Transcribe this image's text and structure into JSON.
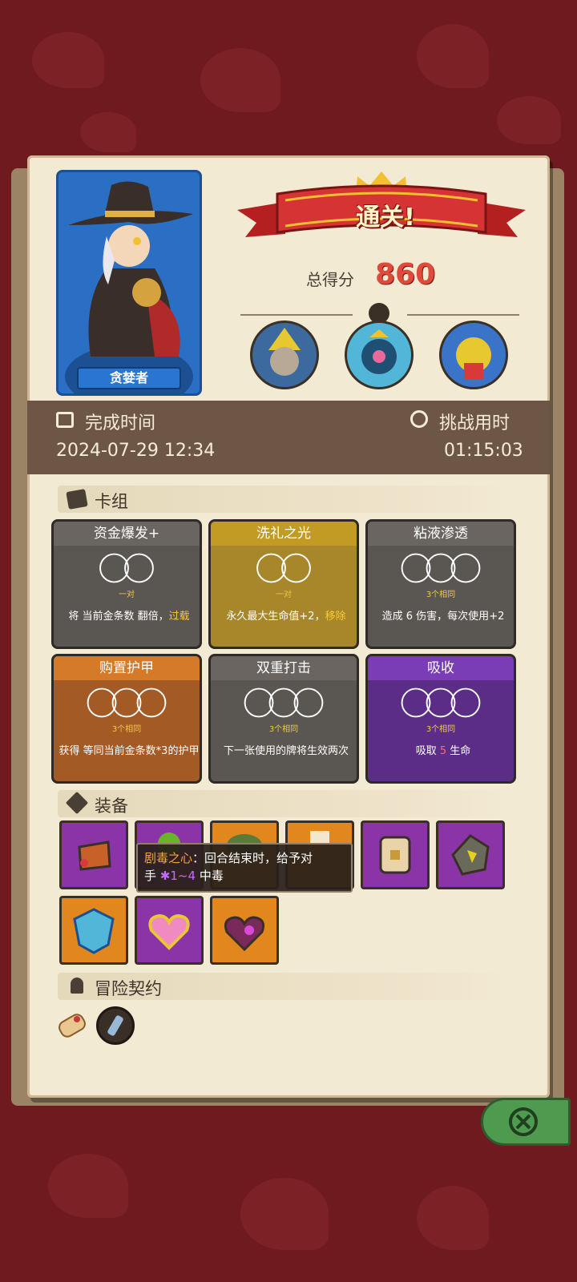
{
  "result": {
    "banner": "通关!",
    "score_label": "总得分",
    "score_value": "860"
  },
  "character": {
    "name": "贪婪者"
  },
  "stats": {
    "completion_label": "完成时间",
    "completion_value": "2024-07-29 12:34",
    "duration_label": "挑战用时",
    "duration_value": "01:15:03"
  },
  "deck": {
    "title": "卡组",
    "cards": [
      {
        "name": "资金爆发+",
        "sub": "一对",
        "desc_a": "将 当前",
        "desc_b": "金条数 翻倍，",
        "desc_hl": "过载",
        "color": "#5a5652",
        "head": "#6a6561"
      },
      {
        "name": "洗礼之光",
        "sub": "一对",
        "desc_a": "永久最大生命值",
        "desc_b": "+2，",
        "desc_hl": "移除",
        "color": "#a8862a",
        "head": "#c29b24"
      },
      {
        "name": "粘液渗透",
        "sub": "3个相同",
        "desc_a": "造成",
        "desc_b": "6 伤害，每次使用",
        "desc_hl": "+2",
        "color": "#5a5652",
        "head": "#6a6561"
      },
      {
        "name": "购置护甲",
        "sub": "3个相同",
        "desc_a": "获得 等同当前",
        "desc_b": "金条数*3",
        "desc_hl": "的护甲",
        "color": "#a35a25",
        "head": "#d57a28"
      },
      {
        "name": "双重打击",
        "sub": "3个相同",
        "desc_a": "下一张使用的牌将生效两",
        "desc_b": "",
        "desc_hl": "次",
        "color": "#5a5652",
        "head": "#6a6561"
      },
      {
        "name": "吸收",
        "sub": "3个相同",
        "desc_a": "吸取",
        "desc_b": "5",
        "desc_hl": "生命",
        "color": "#5b2d87",
        "head": "#7a3db5"
      }
    ]
  },
  "equipment": {
    "title": "装备",
    "tooltip_name": "剧毒之心",
    "tooltip_text": "：回合结束时，给予对",
    "tooltip_line2_a": "手",
    "tooltip_poison": "1~4",
    "tooltip_line2_b": "中毒"
  },
  "contracts": {
    "title": "冒险契约"
  },
  "icons": {
    "completion": "film-icon",
    "duration": "stopwatch-icon",
    "deck": "cards-icon",
    "equipment": "cube-icon",
    "contracts": "person-icon",
    "close": "close-icon"
  }
}
